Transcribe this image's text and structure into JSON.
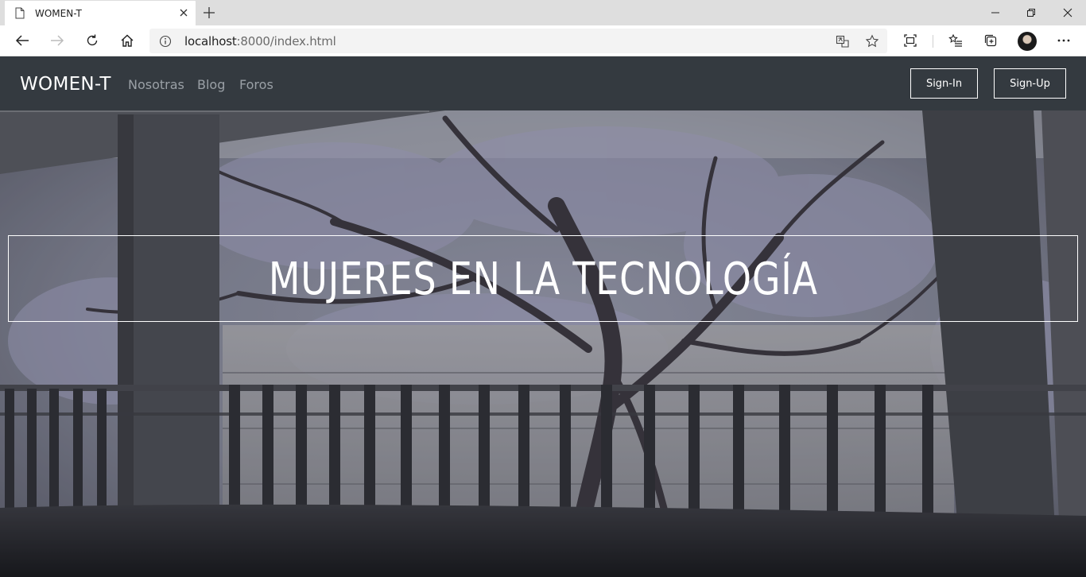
{
  "browser": {
    "tab_title": "WOMEN-T",
    "url_host": "localhost",
    "url_rest": ":8000/index.html"
  },
  "navbar": {
    "brand": "WOMEN-T",
    "links": [
      "Nosotras",
      "Blog",
      "Foros"
    ],
    "signin_label": "Sign-In",
    "signup_label": "Sign-Up"
  },
  "hero": {
    "title": "MUJERES EN LA TECNOLOGÍA"
  },
  "icons": {
    "tab": "page-icon",
    "close": "close-icon",
    "new_tab": "plus-icon",
    "back": "back-arrow-icon",
    "forward": "forward-arrow-icon",
    "refresh": "refresh-icon",
    "home": "home-icon",
    "info": "info-icon",
    "translate": "translate-icon",
    "favorite": "star-icon",
    "immersive": "immersive-reader-icon",
    "favorites": "favorites-list-icon",
    "collections": "collections-icon",
    "more": "more-icon"
  },
  "colors": {
    "navbar_bg": "#343a40",
    "nav_link": "#9aa0a6",
    "hero_tint": "#7a7d86"
  }
}
